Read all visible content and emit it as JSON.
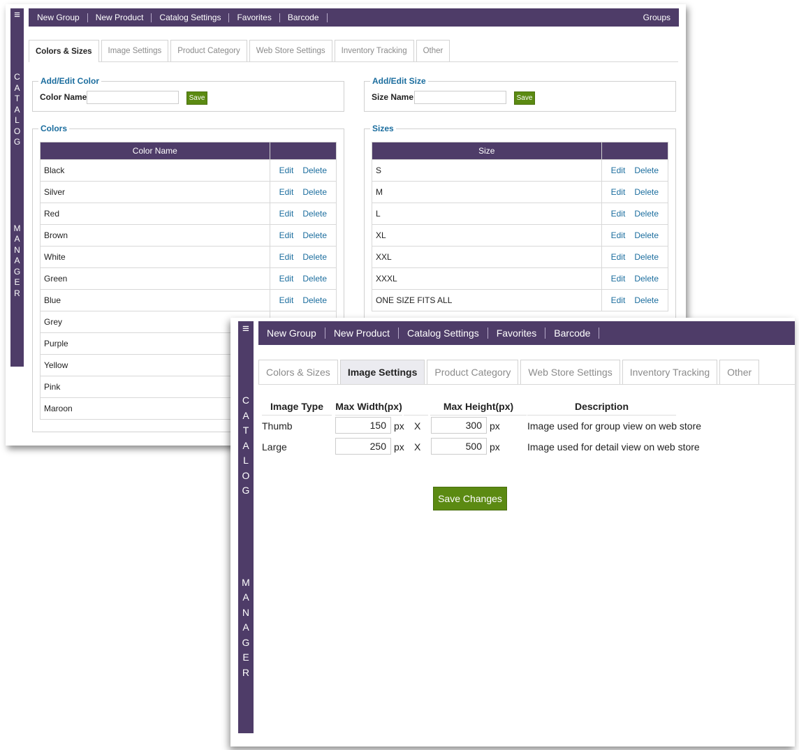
{
  "nav": {
    "items": [
      "New Group",
      "New Product",
      "Catalog Settings",
      "Favorites",
      "Barcode"
    ],
    "right": "Groups"
  },
  "sidebar": {
    "top": "CATALOG",
    "bottom": "MANAGER",
    "menu_icon": "≡"
  },
  "tabs": [
    "Colors & Sizes",
    "Image Settings",
    "Product Category",
    "Web Store Settings",
    "Inventory Tracking",
    "Other"
  ],
  "colors_sizes": {
    "add_color": {
      "legend": "Add/Edit Color",
      "label": "Color Name",
      "value": "",
      "save": "Save"
    },
    "add_size": {
      "legend": "Add/Edit Size",
      "label": "Size Name",
      "value": "",
      "save": "Save"
    },
    "colors": {
      "legend": "Colors",
      "header": "Color Name",
      "rows": [
        "Black",
        "Silver",
        "Red",
        "Brown",
        "White",
        "Green",
        "Blue",
        "Grey",
        "Purple",
        "Yellow",
        "Pink",
        "Maroon"
      ]
    },
    "sizes": {
      "legend": "Sizes",
      "header": "Size",
      "rows": [
        "S",
        "M",
        "L",
        "XL",
        "XXL",
        "XXXL",
        "ONE SIZE FITS ALL"
      ]
    },
    "edit_label": "Edit",
    "delete_label": "Delete"
  },
  "image_settings": {
    "headers": {
      "type": "Image Type",
      "width": "Max Width(px)",
      "height": "Max Height(px)",
      "description": "Description"
    },
    "rows": [
      {
        "type": "Thumb",
        "width": "150",
        "height": "300",
        "description": "Image used for group view on web store"
      },
      {
        "type": "Large",
        "width": "250",
        "height": "500",
        "description": "Image used for detail view on web store"
      }
    ],
    "unit": "px",
    "separator": "X",
    "save": "Save Changes"
  },
  "colors": {
    "nav_bg": "#4e3c68",
    "accent_link": "#1b6d9e",
    "save_green": "#5b8a12"
  }
}
